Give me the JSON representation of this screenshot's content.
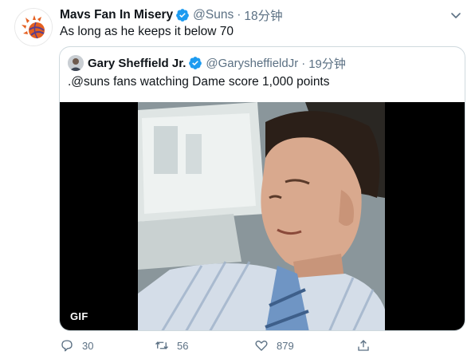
{
  "tweet": {
    "name": "Mavs Fan In Misery",
    "handle": "@Suns",
    "dot": "·",
    "time": "18分钟",
    "text": "As long as he keeps it below 70",
    "avatar_icon": "suns-logo-icon"
  },
  "quoted_tweet": {
    "name": "Gary Sheffield Jr.",
    "handle": "@GarysheffieldJr",
    "dot": "·",
    "time": "19分钟",
    "text": ".@suns fans watching Dame score 1,000 points",
    "media_badge": "GIF"
  },
  "actions": {
    "reply_count": "30",
    "retweet_count": "56",
    "like_count": "879"
  },
  "colors": {
    "verified": "#1d9bf0",
    "secondary_text": "#5b7083",
    "border": "#cfd9de",
    "suns_orange": "#e56020",
    "suns_purple": "#5a3e8c"
  }
}
